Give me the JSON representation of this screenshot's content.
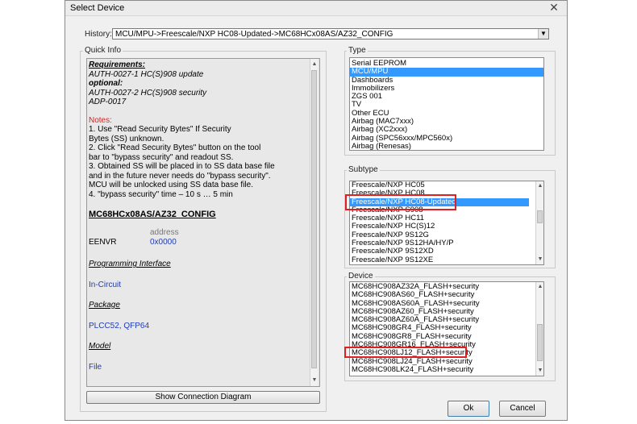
{
  "window": {
    "title": "Select Device",
    "close_glyph": "✕"
  },
  "history": {
    "label": "History:",
    "value": "MCU/MPU->Freescale/NXP HC08-Updated->MC68HCx08AS/AZ32_CONFIG"
  },
  "quick_info": {
    "label": "Quick Info",
    "requirements_label": "Requirements:",
    "req_line1": "AUTH-0027-1 HC(S)908  update",
    "optional_label": "optional:",
    "opt_line1": "AUTH-0027-2 HC(S)908  security",
    "opt_line2": "ADP-0017",
    "notes_label": "Notes:",
    "notes": [
      "1. Use \"Read Security Bytes\" If Security",
      "Bytes (SS) unknown.",
      "2. Click \"Read Security Bytes\" button on the tool",
      "bar to \"bypass security\" and readout SS.",
      "3. Obtained SS will be placed in to SS data base file",
      "and in the future never needs do \"bypass security\".",
      "MCU will be unlocked using SS data base file.",
      "4. \"bypass security\" time – 10 s … 5 min"
    ],
    "config_title": "MC68HCx08AS/AZ32_CONFIG",
    "address_header": "address",
    "reg_name": "EENVR",
    "reg_addr": "0x0000",
    "prog_interface_label": "Programming Interface",
    "prog_interface_value": "In-Circuit",
    "package_label": "Package",
    "package_value": "PLCC52, QFP64",
    "model_label": "Model",
    "model_value": "File"
  },
  "show_diagram_button": "Show Connection Diagram",
  "type": {
    "label": "Type",
    "items": [
      "Serial EEPROM",
      "MCU/MPU",
      "Dashboards",
      "Immobilizers",
      "ZGS 001",
      "TV",
      "Other ECU",
      "Airbag (MAC7xxx)",
      "Airbag (XC2xxx)",
      "Airbag (SPC56xxx/MPC560x)",
      "Airbag (Renesas)"
    ],
    "selected_index": 1
  },
  "subtype": {
    "label": "Subtype",
    "items": [
      "Freescale/NXP HC05",
      "Freescale/NXP HC08",
      "Freescale/NXP HC08-Updated",
      "Freescale/NXP S908",
      "Freescale/NXP HC11",
      "Freescale/NXP HC(S)12",
      "Freescale/NXP 9S12G",
      "Freescale/NXP 9S12HA/HY/P",
      "Freescale/NXP 9S12XD",
      "Freescale/NXP 9S12XE"
    ],
    "selected_index": 2
  },
  "device": {
    "label": "Device",
    "items": [
      "MC68HC908AZ32A_FLASH+security",
      "MC68HC908AS60_FLASH+security",
      "MC68HC908AS60A_FLASH+security",
      "MC68HC908AZ60_FLASH+security",
      "MC68HC908AZ60A_FLASH+security",
      "MC68HC908GR4_FLASH+security",
      "MC68HC908GR8_FLASH+security",
      "MC68HC908GR16_FLASH+security",
      "MC68HC908LJ12_FLASH+security",
      "MC68HC908LJ24_FLASH+security",
      "MC68HC908LK24_FLASH+security"
    ],
    "highlighted_index": 8
  },
  "ok_button": "Ok",
  "cancel_button": "Cancel",
  "colors": {
    "selection": "#3399ff",
    "annotation_red": "#e02020",
    "link_blue": "#1e3cb4"
  }
}
